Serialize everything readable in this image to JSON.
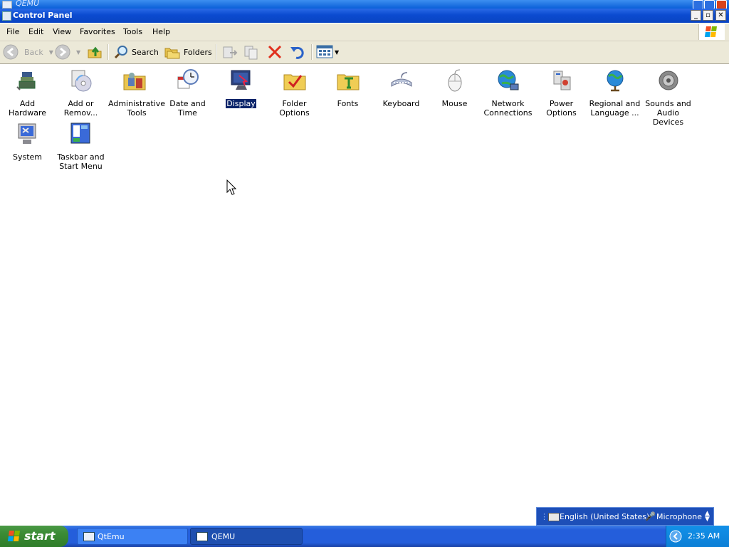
{
  "outer_window": {
    "title": "QEMU"
  },
  "window": {
    "title": "Control Panel"
  },
  "menu": [
    "File",
    "Edit",
    "View",
    "Favorites",
    "Tools",
    "Help"
  ],
  "toolbar": {
    "back": "Back",
    "search": "Search",
    "folders": "Folders"
  },
  "items": [
    {
      "label": "Add Hardware",
      "icon": "add-hardware-icon"
    },
    {
      "label": "Add or Remov...",
      "icon": "add-remove-programs-icon"
    },
    {
      "label": "Administrative Tools",
      "icon": "administrative-tools-icon"
    },
    {
      "label": "Date and Time",
      "icon": "date-time-icon"
    },
    {
      "label": "Display",
      "icon": "display-icon",
      "selected": true
    },
    {
      "label": "Folder Options",
      "icon": "folder-options-icon"
    },
    {
      "label": "Fonts",
      "icon": "fonts-icon"
    },
    {
      "label": "Keyboard",
      "icon": "keyboard-icon"
    },
    {
      "label": "Mouse",
      "icon": "mouse-icon"
    },
    {
      "label": "Network Connections",
      "icon": "network-connections-icon"
    },
    {
      "label": "Power Options",
      "icon": "power-options-icon"
    },
    {
      "label": "Regional and Language ...",
      "icon": "regional-language-icon"
    },
    {
      "label": "Sounds and Audio Devices",
      "icon": "sounds-audio-icon"
    },
    {
      "label": "System",
      "icon": "system-icon"
    },
    {
      "label": "Taskbar and Start Menu",
      "icon": "taskbar-start-menu-icon"
    }
  ],
  "language_bar": {
    "language": "English (United States)",
    "microphone": "Microphone"
  },
  "taskbar": {
    "start": "start",
    "tasks": [
      {
        "label": "QtEmu"
      },
      {
        "label": "QEMU",
        "active": true
      }
    ],
    "clock": "2:35 AM"
  }
}
